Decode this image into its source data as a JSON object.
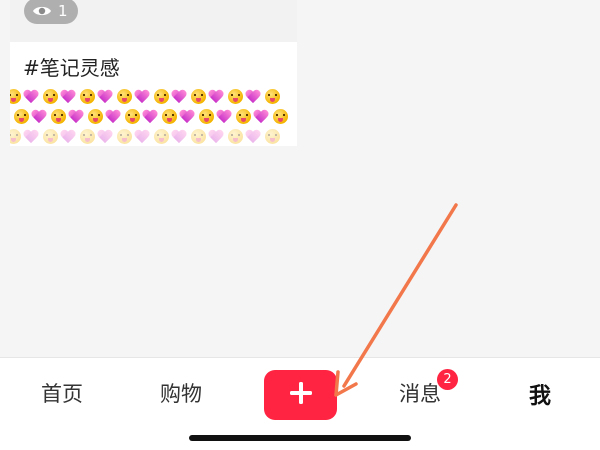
{
  "note": {
    "view_count": "1",
    "view_icon": "eye-icon",
    "title": "#笔记灵感",
    "emoji_pattern": [
      "face-with-tongue",
      "heart"
    ]
  },
  "bottom_nav": {
    "home_label": "首页",
    "shop_label": "购物",
    "publish_icon": "plus-icon",
    "messages_label": "消息",
    "messages_badge": "2",
    "me_label": "我"
  },
  "colors": {
    "accent": "#ff2442",
    "annotation_arrow": "#f2784b",
    "background": "#f5f5f5"
  }
}
